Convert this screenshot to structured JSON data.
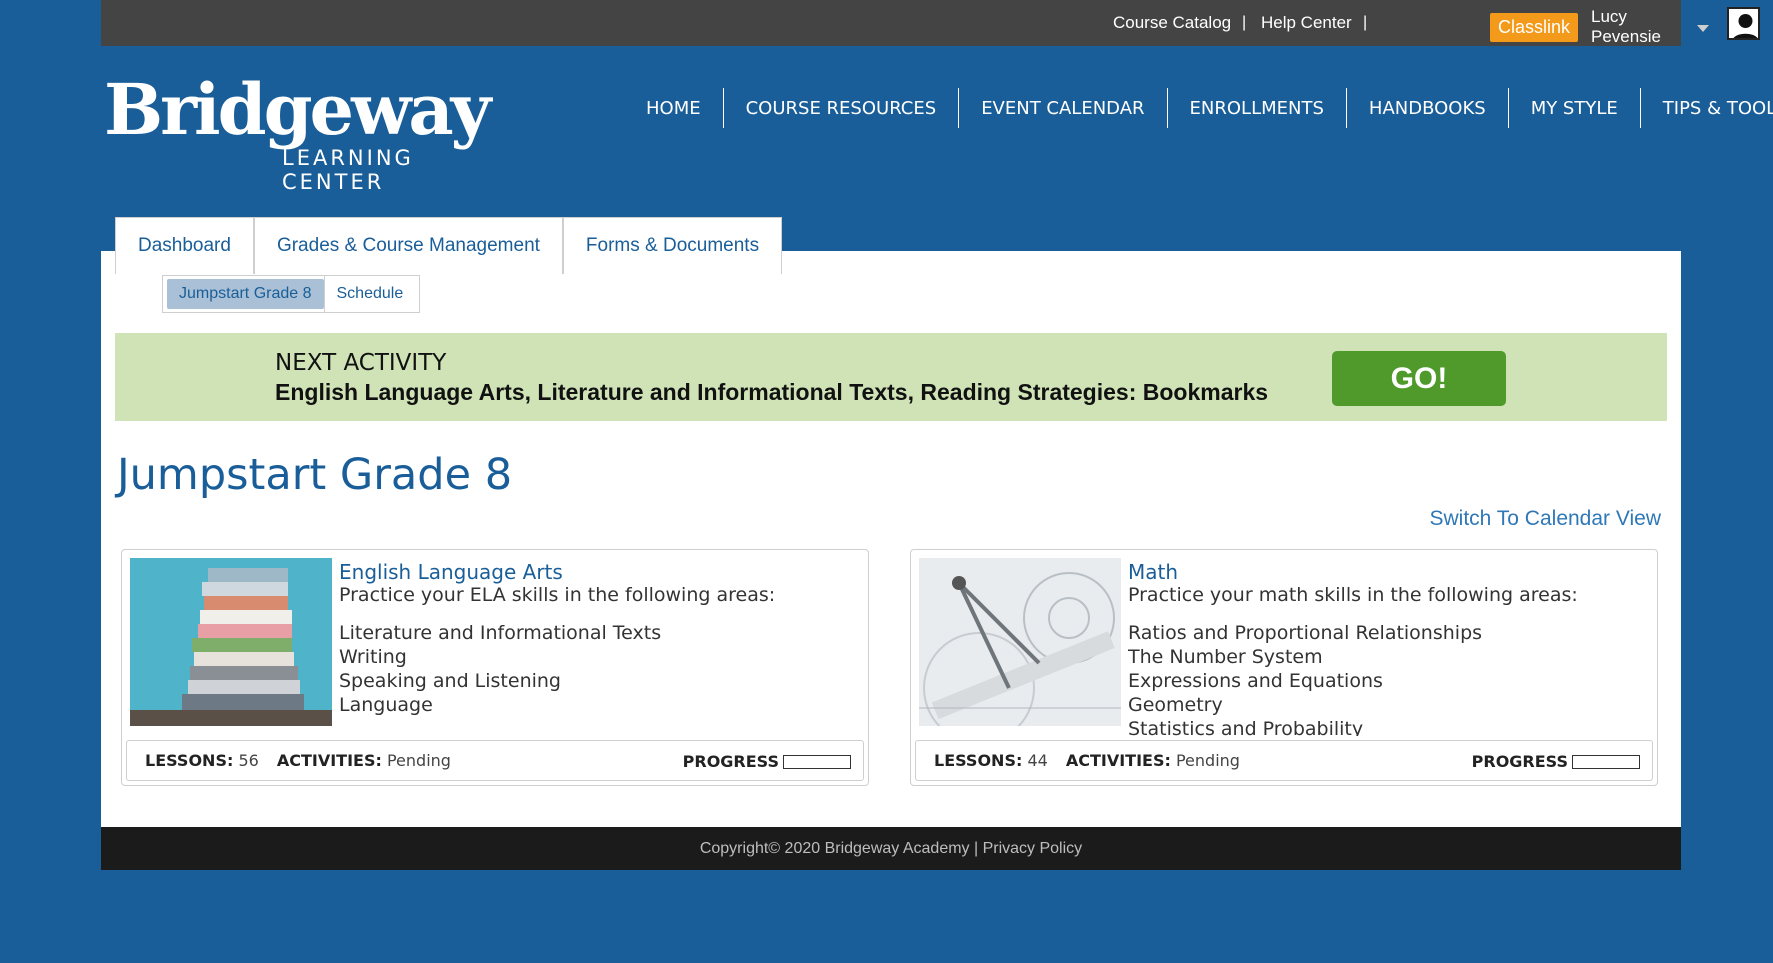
{
  "topbar": {
    "links": [
      "Course Catalog",
      "Help Center"
    ],
    "separator": "|",
    "classlink": "Classlink",
    "user": "Lucy Pevensie"
  },
  "logo": {
    "main": "Bridgeway",
    "sub": "LEARNING CENTER"
  },
  "nav": [
    "HOME",
    "COURSE RESOURCES",
    "EVENT CALENDAR",
    "ENROLLMENTS",
    "HANDBOOKS",
    "MY STYLE",
    "TIPS & TOOLS"
  ],
  "tabs": [
    "Dashboard",
    "Grades & Course Management",
    "Forms & Documents"
  ],
  "subtabs": [
    "Jumpstart Grade 8",
    "Schedule"
  ],
  "next_activity": {
    "heading": "NEXT ACTIVITY",
    "title": "English Language Arts, Literature and Informational Texts, Reading Strategies: Bookmarks",
    "button": "GO!"
  },
  "page_title": "Jumpstart Grade 8",
  "switch_link": "Switch To Calendar View",
  "courses": [
    {
      "title": "English Language Arts",
      "description": "Practice your ELA skills in the following areas:",
      "areas": [
        "Literature and Informational Texts",
        "Writing",
        "Speaking and Listening",
        "Language"
      ],
      "lessons_label": "LESSONS:",
      "lessons": "56",
      "activities_label": "ACTIVITIES:",
      "activities": "Pending",
      "progress_label": "PROGRESS",
      "progress": 0
    },
    {
      "title": "Math",
      "description": "Practice your math skills in the following areas:",
      "areas": [
        "Ratios and Proportional Relationships",
        "The Number System",
        "Expressions and Equations",
        "Geometry",
        "Statistics and Probability"
      ],
      "lessons_label": "LESSONS:",
      "lessons": "44",
      "activities_label": "ACTIVITIES:",
      "activities": "Pending",
      "progress_label": "PROGRESS",
      "progress": 0
    }
  ],
  "footer": "Copyright© 2020 Bridgeway Academy | Privacy Policy",
  "colors": {
    "brand_blue": "#1a5e99",
    "classlink_orange": "#f39a1a",
    "go_green": "#4f9a2b",
    "banner_green": "#cfe3b6"
  }
}
